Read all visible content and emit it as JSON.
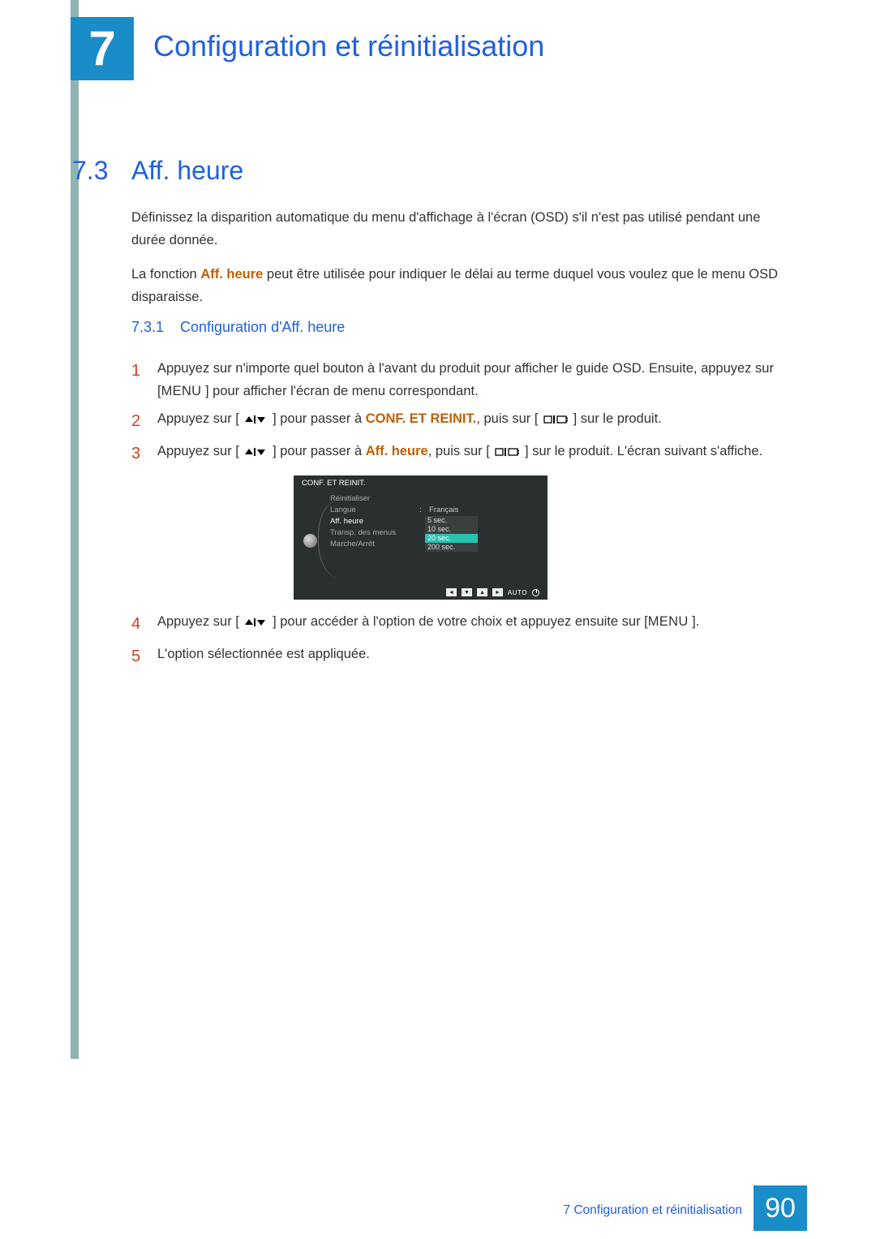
{
  "chapter": {
    "number": "7",
    "title": "Configuration et réinitialisation"
  },
  "section": {
    "number": "7.3",
    "title": "Aff. heure"
  },
  "para1": "Définissez la disparition automatique du menu d'affichage à l'écran (OSD) s'il n'est pas utilisé pendant une durée donnée.",
  "para2_prefix": "La fonction ",
  "para2_emph": "Aff. heure",
  "para2_suffix": " peut être utilisée pour indiquer le délai au terme duquel vous voulez que le menu OSD disparaisse.",
  "subsection": {
    "number": "7.3.1",
    "title": "Configuration d'Aff. heure"
  },
  "steps": {
    "s1_a": "Appuyez sur n'importe quel bouton à l'avant du produit pour afficher le guide OSD. Ensuite, appuyez sur [",
    "s1_menu": "MENU",
    "s1_b": " ] pour afficher l'écran de menu correspondant.",
    "s2_a": "Appuyez sur [ ",
    "s2_b": " ] pour passer à ",
    "s2_emph": "CONF. ET REINIT.",
    "s2_c": ", puis sur [ ",
    "s2_d": " ] sur le produit.",
    "s3_a": "Appuyez sur [ ",
    "s3_b": " ] pour passer à ",
    "s3_emph": "Aff. heure",
    "s3_c": ", puis sur [ ",
    "s3_d": " ] sur le produit. L'écran suivant s'affiche.",
    "s4_a": "Appuyez sur [ ",
    "s4_b": " ] pour accéder à l'option de votre choix et appuyez ensuite sur [",
    "s4_menu": "MENU",
    "s4_c": " ].",
    "s5": "L'option sélectionnée est appliquée."
  },
  "osd": {
    "header": "CONF. ET REINIT.",
    "items": [
      {
        "label": "Réinitialiser",
        "value": ""
      },
      {
        "label": "Langue",
        "value": "Français"
      },
      {
        "label": "Aff. heure",
        "value": "",
        "highlight": true
      },
      {
        "label": "Transp. des menus",
        "value": ""
      },
      {
        "label": "Marche/Arrêt",
        "value": ""
      }
    ],
    "dropdown": [
      "5 sec.",
      "10 sec.",
      "20 sec.",
      "200 sec."
    ],
    "dropdown_selected_index": 2,
    "auto_label": "AUTO"
  },
  "footer": {
    "text": "7 Configuration et réinitialisation",
    "page": "90"
  }
}
